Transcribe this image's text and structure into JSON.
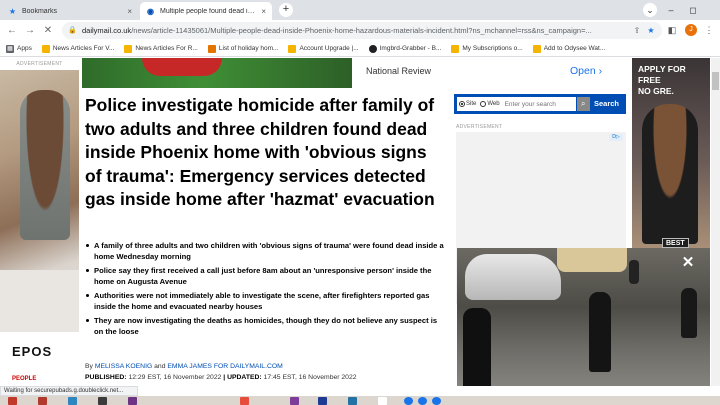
{
  "browser": {
    "tabs": [
      {
        "label": "Bookmarks",
        "icon": "star-icon",
        "close": "×"
      },
      {
        "label": "Multiple people found dead insi...",
        "icon": "dm-icon",
        "close": "×"
      }
    ],
    "new_tab_label": "+",
    "window_controls": [
      "⌄",
      "–",
      "◻"
    ],
    "url_host": "dailymail.co.uk",
    "url_path": "/news/article-11435061/Multiple-people-dead-inside-Phoenix-home-hazardous-materials-incident.html?ns_mchannel=rss&ns_campaign=...",
    "avatar_letter": "J",
    "accent": "#1a73e8"
  },
  "bookmarks": [
    {
      "label": "Apps",
      "color": "#5f6368"
    },
    {
      "label": "News Articles For V...",
      "color": "#f4b400"
    },
    {
      "label": "News Articles For R...",
      "color": "#f4b400"
    },
    {
      "label": "List of holiday hom...",
      "color": "#e37400"
    },
    {
      "label": "Account Upgrade |...",
      "color": "#f4b400"
    },
    {
      "label": "Imgbrd-Grabber - B...",
      "color": "#202124"
    },
    {
      "label": "My Subscriptions o...",
      "color": "#f4b400"
    },
    {
      "label": "Add to Odysee Wat...",
      "color": "#f4b400"
    }
  ],
  "page": {
    "ad_label": "ADVERTISEMENT",
    "ad_brand": "EPOS",
    "ad_sub": "PEOPLE",
    "banner_text": "National Review",
    "banner_open": "Open",
    "banner_open_chevron": "›",
    "headline": "Police investigate homicide after family of two adults and three children found dead inside Phoenix home with 'obvious signs of trauma': Emergency services detected gas inside home after 'hazmat' evacuation",
    "bullets": [
      "A family of three adults and two children with 'obvious signs of trauma' were found dead inside a home Wednesday morning",
      "Police say they first received a call just before 8am about an 'unresponsive person' inside the home on Augusta Avenue",
      "Authorities were not immediately able to investigate the scene, after firefighters reported gas inside the home and evacuated nearby houses",
      "They are now investigating the deaths as homicides, though they do not believe any suspect is on the loose"
    ],
    "byline_by": "By",
    "author1": "MELISSA KOENIG",
    "byline_and": "and",
    "author2": "EMMA JAMES FOR DAILYMAIL.COM",
    "published_label": "PUBLISHED:",
    "published_value": "12:29 EST, 16 November 2022",
    "updated_label": "| UPDATED:",
    "updated_value": "17:45 EST, 16 November 2022",
    "search": {
      "radio_site": "Site",
      "radio_web": "Web",
      "placeholder": "Enter your search",
      "button": "Search",
      "brand_color": "#004db3"
    },
    "ad_label_right": "ADVERTISEMENT",
    "adchoices": "D▷",
    "right_ad_text": "APPLY FOR FREE\nNO GRE.",
    "video_badge": "BEST",
    "video_close": "✕"
  },
  "status_text": "Waiting for securepubads.g.doubleclick.net..."
}
